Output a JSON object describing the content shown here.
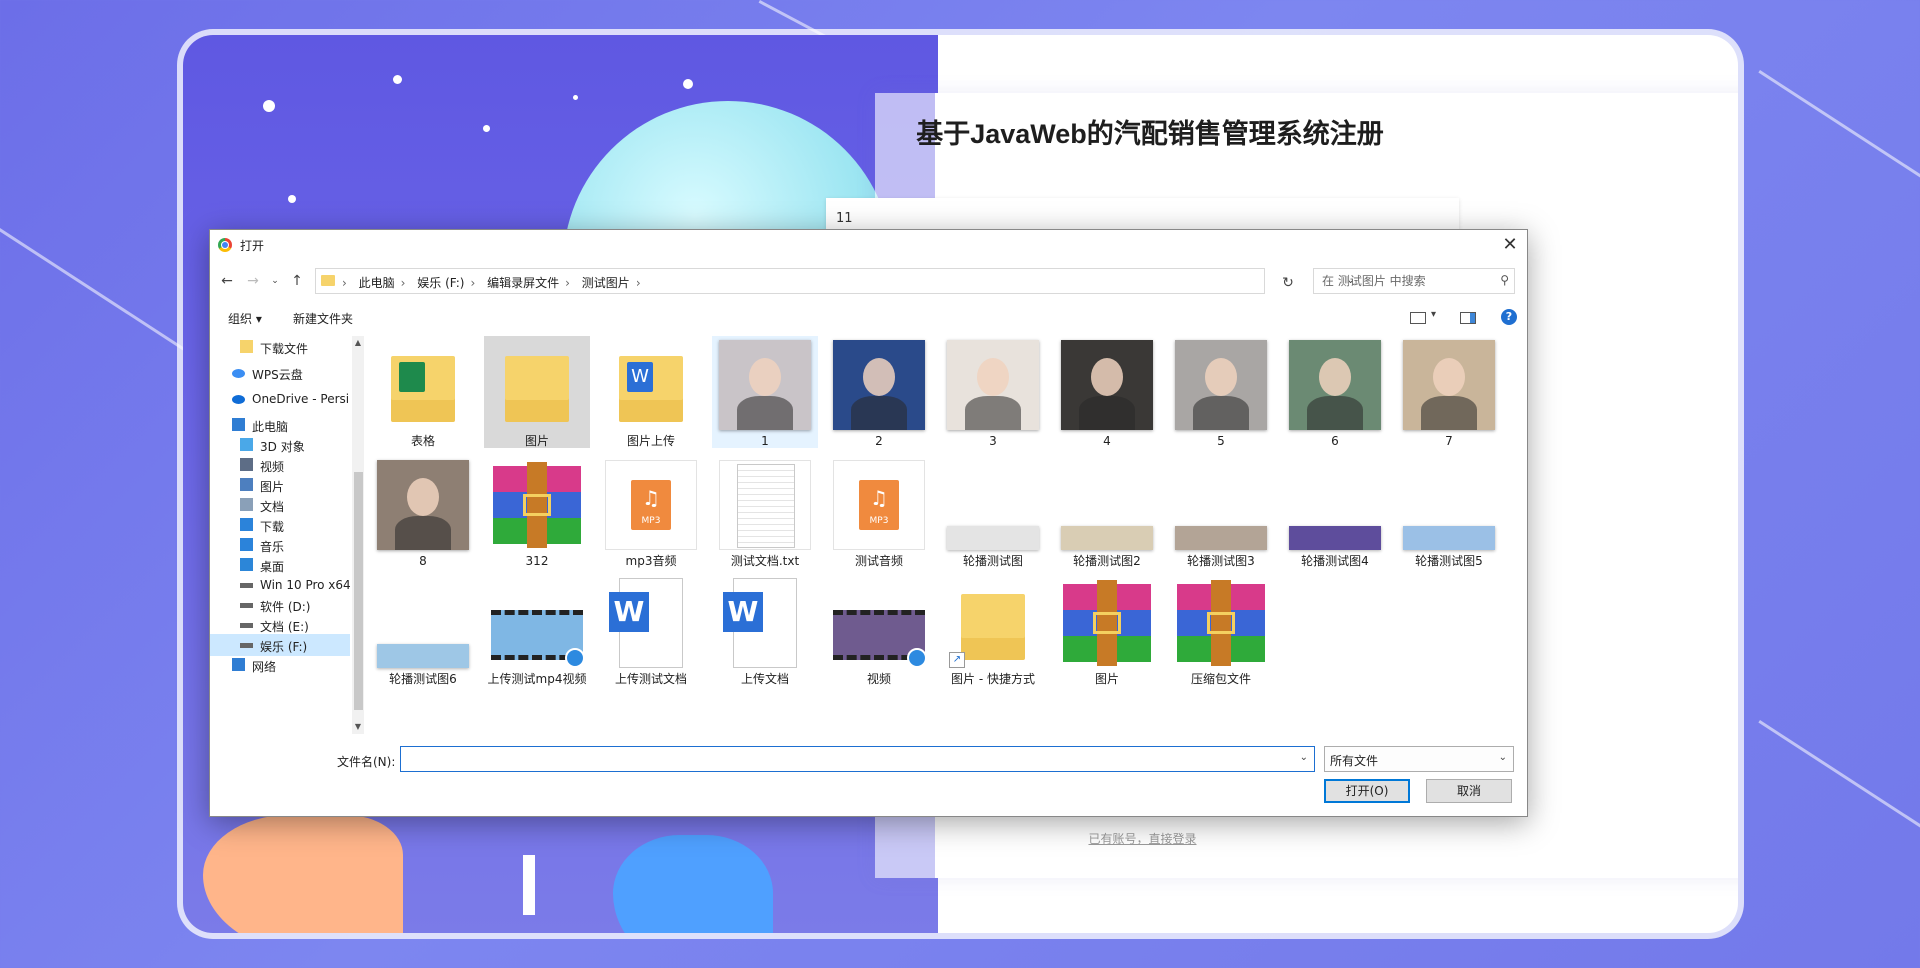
{
  "register": {
    "title": "基于JavaWeb的汽配销售管理系统注册",
    "first_field_value": "11",
    "login_link": "已有账号，直接登录"
  },
  "dialog": {
    "title": "打开",
    "breadcrumbs": [
      "此电脑",
      "娱乐 (F:)",
      "编辑录屏文件",
      "测试图片"
    ],
    "search_placeholder": "在 测试图片 中搜索",
    "toolbar": {
      "organize": "组织 ▾",
      "new_folder": "新建文件夹"
    },
    "sidebar": [
      {
        "label": "下载文件",
        "icon": "folder-icon"
      },
      {
        "label": "WPS云盘",
        "icon": "cloud-icon"
      },
      {
        "label": "OneDrive - Persi",
        "icon": "onedrive-icon"
      },
      {
        "label": "此电脑",
        "icon": "computer-icon"
      },
      {
        "label": "3D 对象",
        "icon": "3d-objects-icon"
      },
      {
        "label": "视频",
        "icon": "video-icon"
      },
      {
        "label": "图片",
        "icon": "pictures-icon"
      },
      {
        "label": "文档",
        "icon": "documents-icon"
      },
      {
        "label": "下载",
        "icon": "download-icon"
      },
      {
        "label": "音乐",
        "icon": "music-icon"
      },
      {
        "label": "桌面",
        "icon": "desktop-icon"
      },
      {
        "label": "Win 10 Pro x64",
        "icon": "drive-icon"
      },
      {
        "label": "软件 (D:)",
        "icon": "drive-icon"
      },
      {
        "label": "文档 (E:)",
        "icon": "drive-icon"
      },
      {
        "label": "娱乐 (F:)",
        "icon": "drive-icon"
      },
      {
        "label": "网络",
        "icon": "network-icon"
      }
    ],
    "files": [
      {
        "label": "表格",
        "kind": "folder-excel"
      },
      {
        "label": "图片",
        "kind": "folder"
      },
      {
        "label": "图片上传",
        "kind": "folder-word"
      },
      {
        "label": "1",
        "kind": "photo",
        "color": "#c9c4c8"
      },
      {
        "label": "2",
        "kind": "photo",
        "color": "#2a4a8a"
      },
      {
        "label": "3",
        "kind": "photo",
        "color": "#e8e2dc"
      },
      {
        "label": "4",
        "kind": "photo",
        "color": "#3a3836"
      },
      {
        "label": "5",
        "kind": "photo",
        "color": "#a9a6a4"
      },
      {
        "label": "6",
        "kind": "photo",
        "color": "#6b8a73"
      },
      {
        "label": "7",
        "kind": "photo",
        "color": "#c9b59a"
      },
      {
        "label": "8",
        "kind": "photo",
        "color": "#8e7f73"
      },
      {
        "label": "312",
        "kind": "archive"
      },
      {
        "label": "mp3音频",
        "kind": "mp3"
      },
      {
        "label": "测试文档.txt",
        "kind": "txt"
      },
      {
        "label": "测试音频",
        "kind": "mp3"
      },
      {
        "label": "轮播测试图",
        "kind": "banner",
        "color": "#e4e4e4"
      },
      {
        "label": "轮播测试图2",
        "kind": "banner",
        "color": "#d9cdb4"
      },
      {
        "label": "轮播测试图3",
        "kind": "banner",
        "color": "#b3a496"
      },
      {
        "label": "轮播测试图4",
        "kind": "banner",
        "color": "#5e4d9c"
      },
      {
        "label": "轮播测试图5",
        "kind": "banner",
        "color": "#9bc0e6"
      },
      {
        "label": "轮播测试图6",
        "kind": "banner",
        "color": "#9ec7e6"
      },
      {
        "label": "上传测试mp4视频",
        "kind": "video",
        "color": "#7fb7e4"
      },
      {
        "label": "上传测试文档",
        "kind": "word"
      },
      {
        "label": "上传文档",
        "kind": "word"
      },
      {
        "label": "视频",
        "kind": "video",
        "color": "#6f5b8f"
      },
      {
        "label": "图片 - 快捷方式",
        "kind": "folder-shortcut"
      },
      {
        "label": "图片",
        "kind": "archive"
      },
      {
        "label": "压缩包文件",
        "kind": "archive"
      }
    ],
    "filename_label": "文件名(N):",
    "filename_value": "",
    "filter_value": "所有文件",
    "open_button": "打开(O)",
    "cancel_button": "取消",
    "colors": {
      "selection": "#cce8ff",
      "accent": "#0078d7",
      "folder": "#f6d36b"
    }
  }
}
